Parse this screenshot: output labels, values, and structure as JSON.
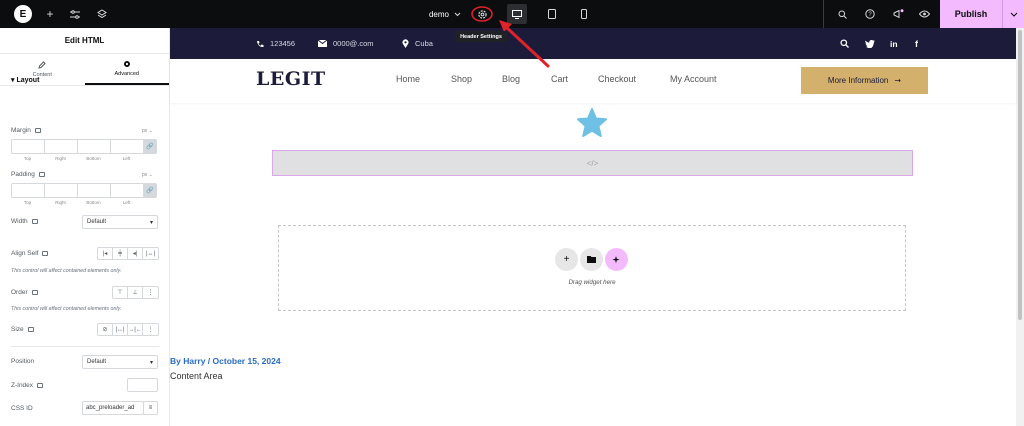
{
  "topbar": {
    "page_name": "demo",
    "publish_label": "Publish",
    "tooltip": "Header Settings",
    "logo_letter": "E"
  },
  "panel": {
    "title": "Edit HTML",
    "tabs": [
      {
        "label": "Content",
        "icon": "pencil-icon"
      },
      {
        "label": "Advanced",
        "icon": "gear-icon"
      }
    ],
    "section_title": "Layout",
    "margin": {
      "label": "Margin",
      "unit": "px",
      "sides": [
        "Top",
        "Right",
        "Bottom",
        "Left"
      ]
    },
    "padding": {
      "label": "Padding",
      "unit": "px",
      "sides": [
        "Top",
        "Right",
        "Bottom",
        "Left"
      ]
    },
    "width": {
      "label": "Width",
      "value": "Default"
    },
    "align_self": {
      "label": "Align Self",
      "note": "This control will affect contained elements only."
    },
    "order": {
      "label": "Order",
      "note": "This control will affect contained elements only."
    },
    "size": {
      "label": "Size"
    },
    "position": {
      "label": "Position",
      "value": "Default"
    },
    "z_index": {
      "label": "Z-Index",
      "value": ""
    },
    "css_id": {
      "label": "CSS ID",
      "value": "abc_preloader_ad"
    }
  },
  "site": {
    "phone": "123456",
    "email": "0000@.com",
    "location": "Cuba",
    "logo": "LEGIT",
    "nav": [
      "Home",
      "Shop",
      "Blog",
      "Cart",
      "Checkout",
      "My Account"
    ],
    "cta_label": "More Information",
    "drag_text": "Drag widget here",
    "post_meta": "By Harry / October 15, 2024",
    "content_text": "Content Area"
  },
  "colors": {
    "topbar_bg": "#0c0d0e",
    "publish_bg": "#f3bafd",
    "infobar_bg": "#1c1c3a",
    "cta_bg": "#d4b06d",
    "star": "#6ec1e4",
    "annotation": "#e0222a",
    "link": "#2a6bc4"
  }
}
